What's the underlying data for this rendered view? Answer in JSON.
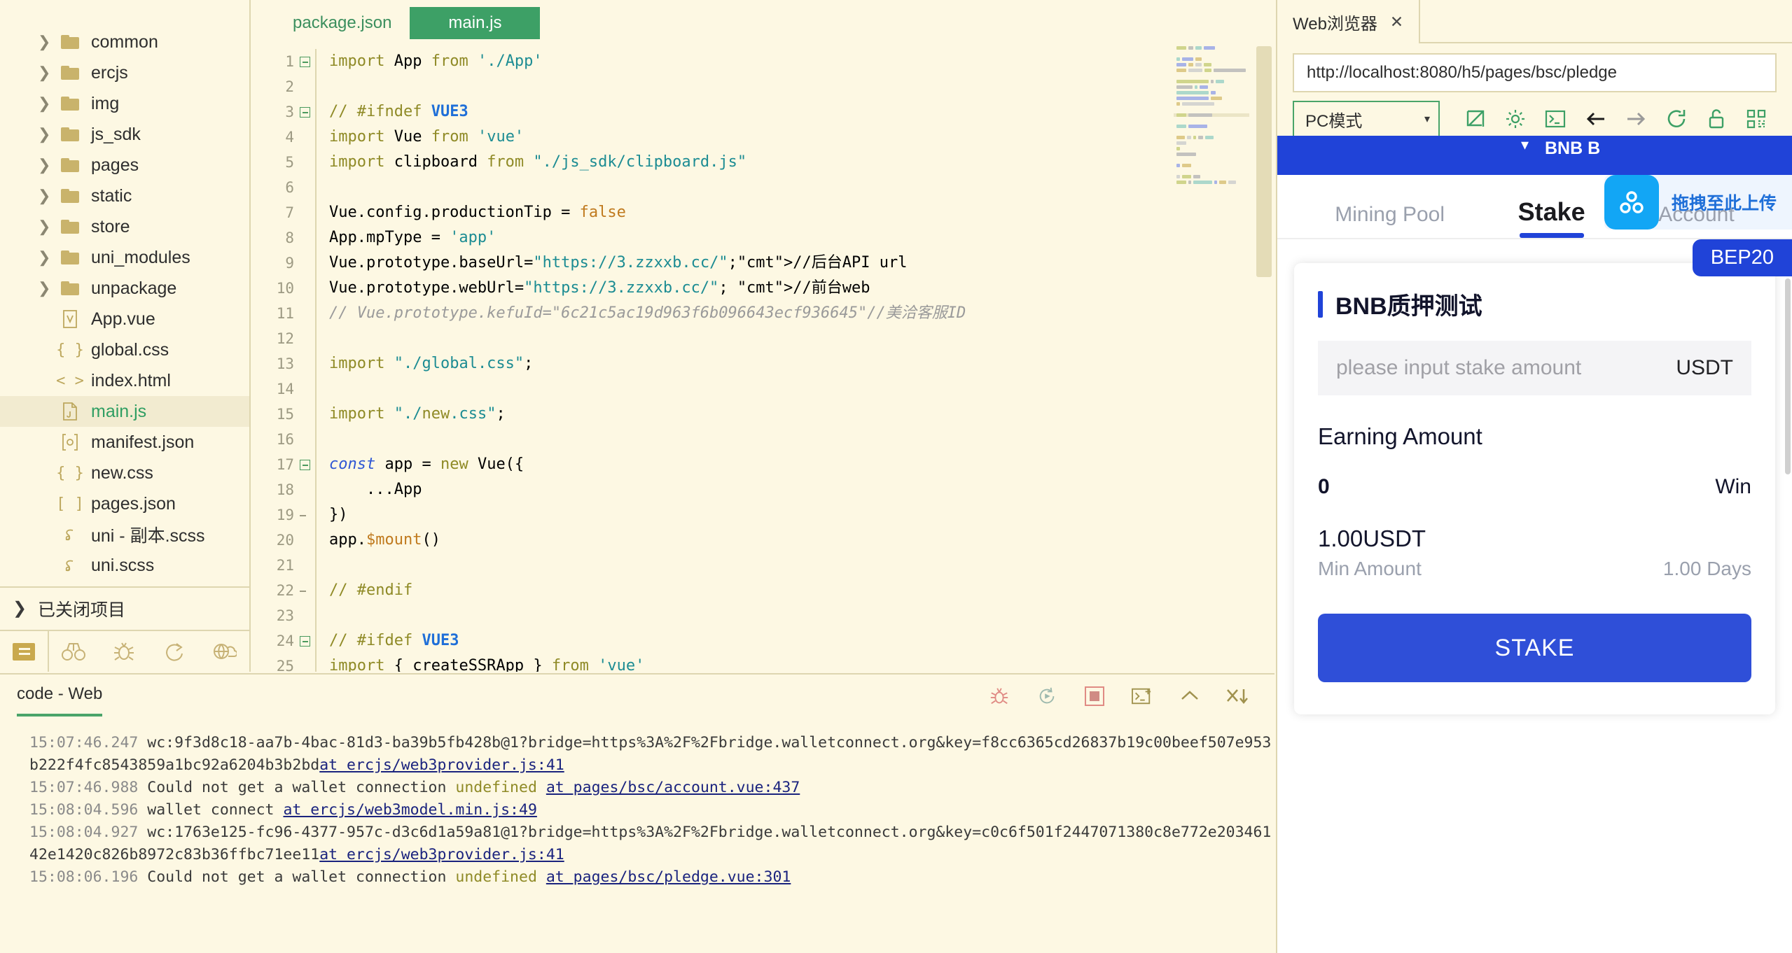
{
  "explorer": {
    "items": [
      {
        "label": "common",
        "type": "folder",
        "expandable": true,
        "selected": false
      },
      {
        "label": "ercjs",
        "type": "folder",
        "expandable": true,
        "selected": false
      },
      {
        "label": "img",
        "type": "folder",
        "expandable": true,
        "selected": false
      },
      {
        "label": "js_sdk",
        "type": "folder",
        "expandable": true,
        "selected": false
      },
      {
        "label": "pages",
        "type": "folder",
        "expandable": true,
        "selected": false
      },
      {
        "label": "static",
        "type": "folder",
        "expandable": true,
        "selected": false
      },
      {
        "label": "store",
        "type": "folder",
        "expandable": true,
        "selected": false
      },
      {
        "label": "uni_modules",
        "type": "folder",
        "expandable": true,
        "selected": false
      },
      {
        "label": "unpackage",
        "type": "folder",
        "expandable": true,
        "selected": false
      },
      {
        "label": "App.vue",
        "type": "vue",
        "expandable": false,
        "selected": false
      },
      {
        "label": "global.css",
        "type": "css",
        "expandable": false,
        "selected": false
      },
      {
        "label": "index.html",
        "type": "html",
        "expandable": false,
        "selected": false
      },
      {
        "label": "main.js",
        "type": "js",
        "expandable": false,
        "selected": true
      },
      {
        "label": "manifest.json",
        "type": "manifest",
        "expandable": false,
        "selected": false
      },
      {
        "label": "new.css",
        "type": "css",
        "expandable": false,
        "selected": false
      },
      {
        "label": "pages.json",
        "type": "pagesjson",
        "expandable": false,
        "selected": false
      },
      {
        "label": "uni - 副本.scss",
        "type": "scss",
        "expandable": false,
        "selected": false
      },
      {
        "label": "uni.scss",
        "type": "scss",
        "expandable": false,
        "selected": false
      }
    ],
    "closed_projects_label": "已关闭项目",
    "toolbar_icons": [
      "files-icon",
      "binoculars-icon",
      "bug-icon",
      "share-icon",
      "cloud-network-icon"
    ]
  },
  "editor": {
    "tabs": [
      {
        "label": "package.json",
        "active": false
      },
      {
        "label": "main.js",
        "active": true
      }
    ],
    "lines": [
      {
        "n": 1,
        "fold": "start",
        "text": "import App from './App'"
      },
      {
        "n": 2,
        "fold": "",
        "text": ""
      },
      {
        "n": 3,
        "fold": "start",
        "text": "// #ifndef VUE3"
      },
      {
        "n": 4,
        "fold": "",
        "text": "import Vue from 'vue'"
      },
      {
        "n": 5,
        "fold": "",
        "text": "import clipboard from \"./js_sdk/clipboard.js\""
      },
      {
        "n": 6,
        "fold": "",
        "text": ""
      },
      {
        "n": 7,
        "fold": "",
        "text": "Vue.config.productionTip = false"
      },
      {
        "n": 8,
        "fold": "",
        "text": "App.mpType = 'app'"
      },
      {
        "n": 9,
        "fold": "",
        "text": "Vue.prototype.baseUrl=\"https://3.zzxxb.cc/\";//后台API url"
      },
      {
        "n": 10,
        "fold": "",
        "text": "Vue.prototype.webUrl=\"https://3.zzxxb.cc/\"; //前台web"
      },
      {
        "n": 11,
        "fold": "",
        "text": "// Vue.prototype.kefuId=\"6c21c5ac19d963f6b096643ecf936645\"//美洽客服ID"
      },
      {
        "n": 12,
        "fold": "",
        "text": ""
      },
      {
        "n": 13,
        "fold": "",
        "text": "import \"./global.css\";"
      },
      {
        "n": 14,
        "fold": "",
        "text": ""
      },
      {
        "n": 15,
        "fold": "",
        "text": "import \"./new.css\";"
      },
      {
        "n": 16,
        "fold": "",
        "text": ""
      },
      {
        "n": 17,
        "fold": "start",
        "text": "const app = new Vue({"
      },
      {
        "n": 18,
        "fold": "",
        "text": "    ...App"
      },
      {
        "n": 19,
        "fold": "end",
        "text": "})"
      },
      {
        "n": 20,
        "fold": "",
        "text": "app.$mount()"
      },
      {
        "n": 21,
        "fold": "",
        "text": ""
      },
      {
        "n": 22,
        "fold": "end",
        "text": "// #endif"
      },
      {
        "n": 23,
        "fold": "",
        "text": ""
      },
      {
        "n": 24,
        "fold": "start",
        "text": "// #ifdef VUE3"
      },
      {
        "n": 25,
        "fold": "",
        "text": "import { createSSRApp } from 'vue'"
      }
    ]
  },
  "console": {
    "tab_label": "code - Web",
    "toolbar_icons": [
      "bug-icon",
      "restart-icon",
      "stop-icon",
      "new-terminal-icon",
      "collapse-icon",
      "clear-icon"
    ],
    "logs": [
      {
        "time": "15:07:46.247",
        "message": "wc:9f3d8c18-aa7b-4bac-81d3-ba39b5fb428b@1?bridge=https%3A%2F%2Fbridge.walletconnect.org&key=f8cc6365cd26837b19c00beef507e953b222f4fc8543859a1bc92a6204b3b2bd",
        "link": "at ercjs/web3provider.js:41"
      },
      {
        "time": "15:07:46.988",
        "message": "Could not get a wallet connection ",
        "undefined_token": "undefined",
        "link": "at pages/bsc/account.vue:437"
      },
      {
        "time": "15:08:04.596",
        "message": "wallet connect ",
        "link": "at ercjs/web3model.min.js:49"
      },
      {
        "time": "15:08:04.927",
        "message": "wc:1763e125-fc96-4377-957c-d3c6d1a59a81@1?bridge=https%3A%2F%2Fbridge.walletconnect.org&key=c0c6f501f2447071380c8e772e20346142e1420c826b8972c83b36ffbc71ee11",
        "link": "at ercjs/web3provider.js:41"
      },
      {
        "time": "15:08:06.196",
        "message": "Could not get a wallet connection ",
        "undefined_token": "undefined",
        "link": "at pages/bsc/pledge.vue:301"
      }
    ]
  },
  "browser": {
    "tab_label": "Web浏览器",
    "close_label": "✕",
    "url": "http://localhost:8080/h5/pages/bsc/pledge",
    "url_placeholder": "http://localhost:8080",
    "mode_label": "PC模式",
    "mode_caret": "▾",
    "toolbar_icons": [
      "open-external-icon",
      "settings-gear-icon",
      "console-icon",
      "back-arrow-icon",
      "forward-arrow-icon",
      "reload-icon",
      "unlock-icon",
      "qrcode-icon"
    ]
  },
  "page": {
    "top_bar": {
      "network_label": "BNB B"
    },
    "drag_overlay": {
      "text": "拖拽至此上传",
      "icon": "upload-cluster-icon"
    },
    "chain_badge": "BEP20",
    "tabs": [
      {
        "label": "Mining Pool",
        "active": false
      },
      {
        "label": "Stake",
        "active": true
      },
      {
        "label": "Account",
        "active": false
      }
    ],
    "card": {
      "title": "BNB质押测试",
      "input_placeholder": "please input stake amount",
      "input_unit": "USDT",
      "earning_label": "Earning Amount",
      "earning_value": "0",
      "earning_unit": "Win",
      "min_amount_value": "1.00USDT",
      "min_amount_label": "Min Amount",
      "days_value": "1.00 Days",
      "stake_button": "STAKE"
    }
  },
  "colors": {
    "ide_bg": "#fdf8e3",
    "accent_green": "#3da066",
    "page_blue": "#2043d8",
    "button_blue": "#2f4fd8",
    "drag_cyan": "#12a6f5"
  }
}
